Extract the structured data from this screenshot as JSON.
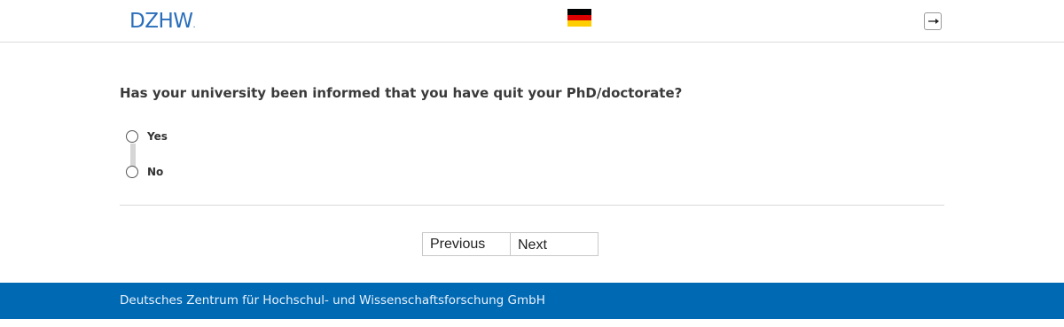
{
  "header": {
    "logo_text": "DZHW",
    "logo_dot": ".",
    "language_flag": "german-flag-icon",
    "flag_colors": [
      "#000000",
      "#dd0000",
      "#ffce00"
    ],
    "exit_icon": "exit-icon"
  },
  "question": {
    "text": "Has your university been informed that you have quit your PhD/doctorate?",
    "options": [
      {
        "label": "Yes",
        "selected": false
      },
      {
        "label": "No",
        "selected": false
      }
    ]
  },
  "navigation": {
    "previous_label": "Previous",
    "next_label": "Next"
  },
  "footer": {
    "text": "Deutsches Zentrum für Hochschul- und Wissenschaftsforschung GmbH",
    "background": "#0069b4"
  }
}
